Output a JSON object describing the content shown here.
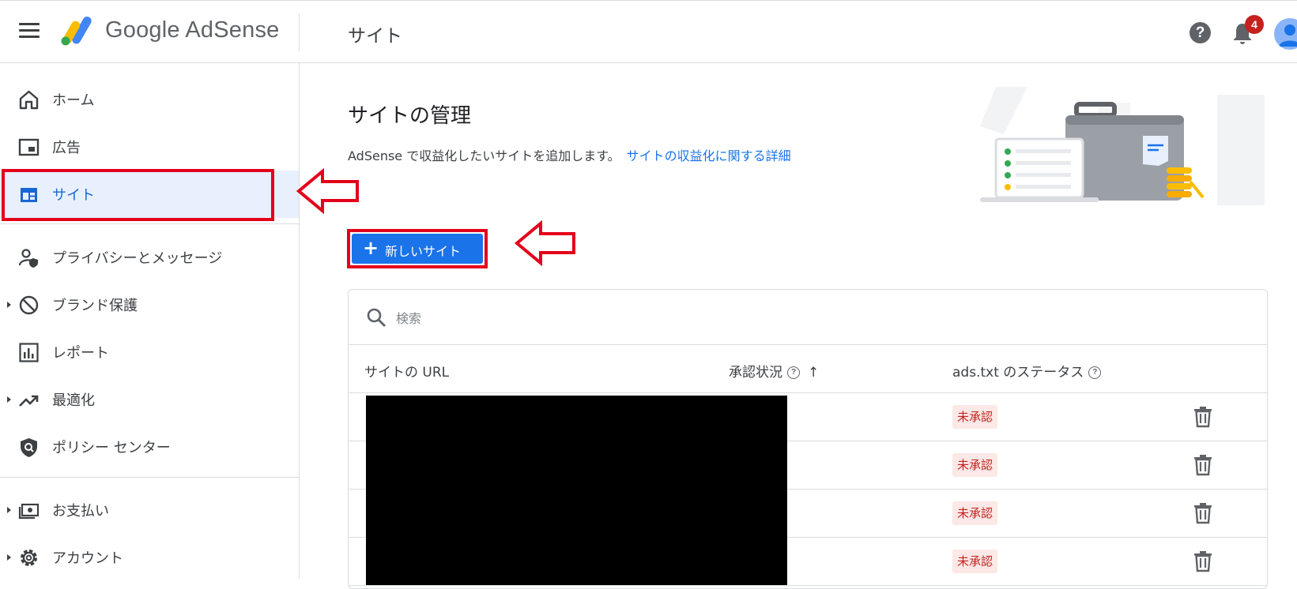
{
  "header": {
    "brand": "Google AdSense",
    "page_title": "サイト",
    "notification_count": "4",
    "help_symbol": "?"
  },
  "sidebar": {
    "items": [
      {
        "label": "ホーム",
        "icon": "home-icon"
      },
      {
        "label": "広告",
        "icon": "ads-icon"
      },
      {
        "label": "サイト",
        "icon": "sites-icon",
        "active": true
      },
      {
        "label": "プライバシーとメッセージ",
        "icon": "privacy-icon"
      },
      {
        "label": "ブランド保護",
        "icon": "block-icon",
        "expandable": true
      },
      {
        "label": "レポート",
        "icon": "reports-icon"
      },
      {
        "label": "最適化",
        "icon": "trending-icon",
        "expandable": true
      },
      {
        "label": "ポリシー センター",
        "icon": "policy-icon"
      },
      {
        "label": "お支払い",
        "icon": "payments-icon",
        "expandable": true
      },
      {
        "label": "アカウント",
        "icon": "gear-icon",
        "expandable": true
      }
    ]
  },
  "main": {
    "title": "サイトの管理",
    "description": "AdSense で収益化したいサイトを追加します。",
    "learn_more": "サイトの収益化に関する詳細",
    "new_site_button": "新しいサイト",
    "search_placeholder": "検索",
    "columns": {
      "url": "サイトの URL",
      "approval": "承認状況",
      "ads_txt": "ads.txt のステータス"
    },
    "rows": [
      {
        "ads_txt_status": "未承認"
      },
      {
        "ads_txt_status": "未承認"
      },
      {
        "ads_txt_status": "未承認"
      },
      {
        "ads_txt_status": "未承認"
      }
    ]
  },
  "colors": {
    "primary": "#1a73e8",
    "annotation_red": "#e3001b",
    "badge_bg": "#fce8e6",
    "badge_text": "#c5221f",
    "active_nav_bg": "#e8f0fe"
  }
}
